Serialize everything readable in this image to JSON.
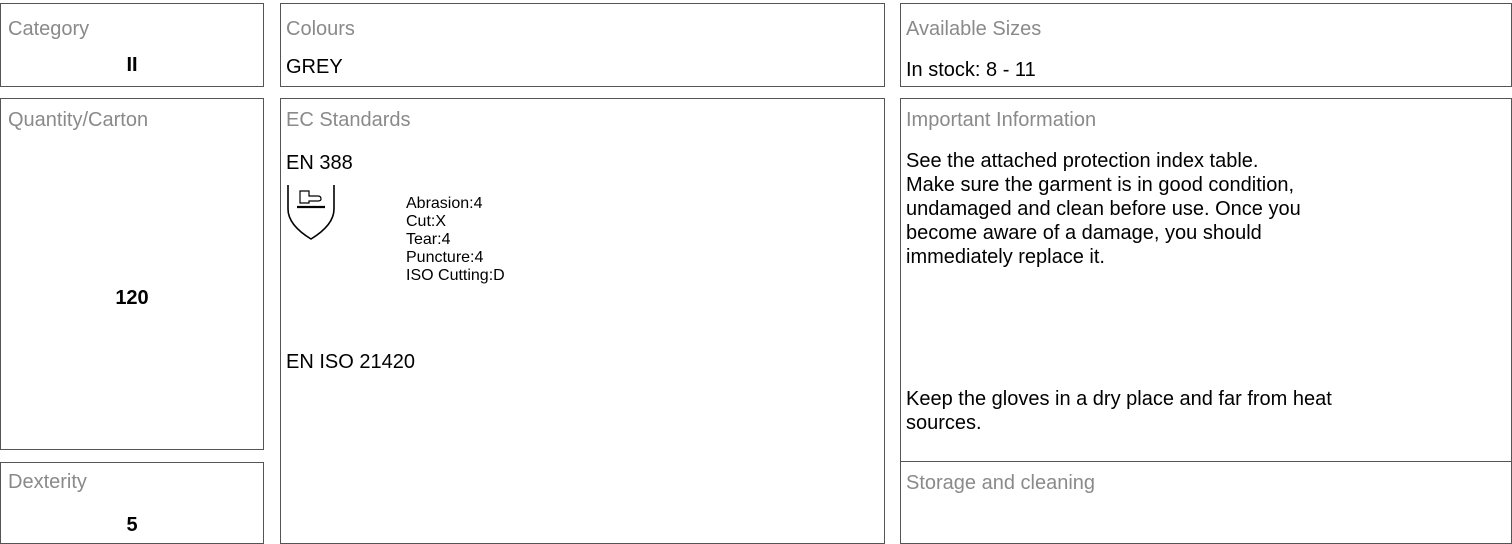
{
  "category": {
    "label": "Category",
    "value": "II"
  },
  "colours": {
    "label": "Colours",
    "value": "GREY"
  },
  "sizes": {
    "label": "Available Sizes",
    "value": "In stock: 8 - 11"
  },
  "quantity": {
    "label": "Quantity/Carton",
    "value": "120"
  },
  "standards": {
    "label": "EC Standards",
    "en388": {
      "title": "EN 388",
      "icon": "glove-shield-icon",
      "ratings": [
        "Abrasion:4",
        "Cut:X",
        "Tear:4",
        "Puncture:4",
        "ISO Cutting:D"
      ]
    },
    "en21420": {
      "title": "EN ISO 21420"
    }
  },
  "important": {
    "label": "Important Information",
    "lines": [
      "See the attached protection index table.",
      "Make sure the garment is in good condition,",
      "undamaged and clean before use. Once you",
      "become aware of a damage, you should",
      "immediately replace it."
    ],
    "storage_lines": [
      "Keep the gloves in a dry place and far from heat",
      "sources."
    ]
  },
  "dexterity": {
    "label": "Dexterity",
    "value": "5"
  },
  "storage": {
    "label": "Storage and cleaning"
  }
}
